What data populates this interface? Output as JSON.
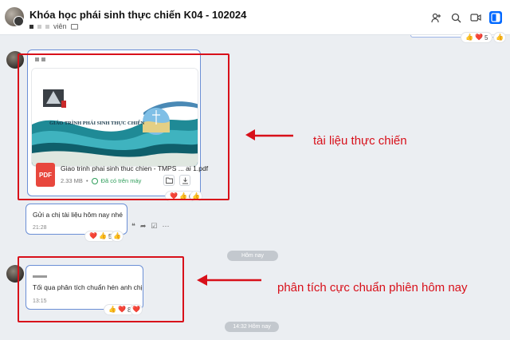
{
  "header": {
    "title": "Khóa học phái sinh thực chiến K04 - 102024",
    "member_label": "viên"
  },
  "reactions": {
    "top_count": "5",
    "file_count": "6",
    "note_count": "5",
    "bottom_count": "8"
  },
  "file_message": {
    "preview_title": "GIÁO TRÌNH PHÁI SINH THỰC CHIẾN",
    "file_badge": "PDF",
    "file_name": "Giao trinh phai sinh thuc chien - TMPS ... ai 1.pdf",
    "file_size": "2.33 MB",
    "cloud_status": "Đã có trên máy"
  },
  "message_note": {
    "text": "Gửi a chị tài liệu hôm nay nhé",
    "time": "21:28"
  },
  "message_analysis": {
    "text": "Tối qua phân tích chuẩn hén anh chị",
    "time": "13:15"
  },
  "separators": {
    "today": "Hôm nay",
    "today_time": "14:32 Hôm nay"
  },
  "annotations": {
    "doc_label": "tài liệu thực chiến",
    "analysis_label": "phân tích cực chuẩn phiên hôm nay",
    "color": "#d8101a"
  },
  "accent_color": "#0068ff"
}
